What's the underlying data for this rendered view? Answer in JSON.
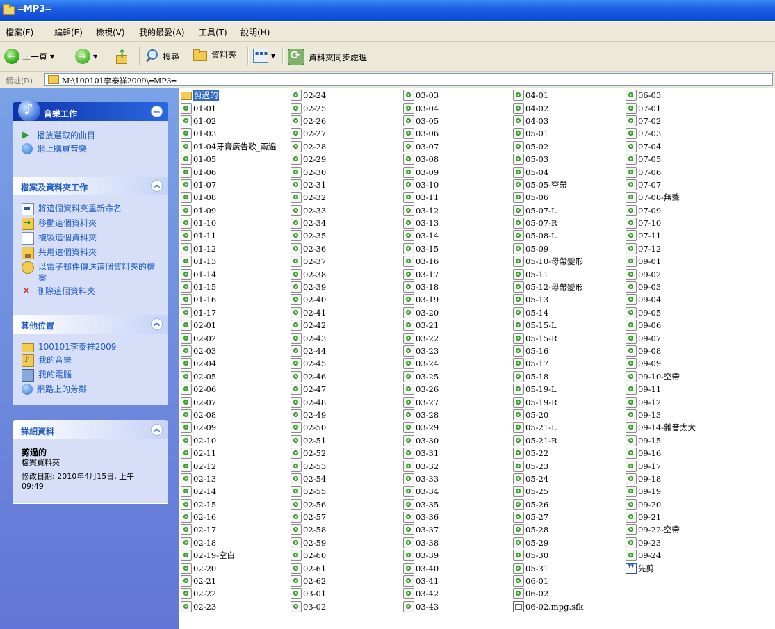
{
  "window": {
    "title": "═MP3═"
  },
  "menu": [
    "檔案(F)",
    "編輯(E)",
    "檢視(V)",
    "我的最愛(A)",
    "工具(T)",
    "說明(H)"
  ],
  "toolbar": {
    "back": "上一頁",
    "search": "搜尋",
    "folders": "資料夾",
    "sync": "資料夾同步處理"
  },
  "address": {
    "label": "網址(D)",
    "path": "M:\\100101李泰祥2009\\═MP3═"
  },
  "music_tasks": {
    "title": "音樂工作",
    "items": [
      "播放選取的曲目",
      "網上購買音樂"
    ]
  },
  "file_tasks": {
    "title": "檔案及資料夾工作",
    "items": [
      "將這個資料夾重新命名",
      "移動這個資料夾",
      "複製這個資料夾",
      "共用這個資料夾",
      "以電子郵件傳送這個資料夾的檔案",
      "刪除這個資料夾"
    ]
  },
  "other_places": {
    "title": "其他位置",
    "items": [
      "100101李泰祥2009",
      "我的音樂",
      "我的電腦",
      "網路上的芳鄰"
    ]
  },
  "details": {
    "title": "詳細資料",
    "name": "剪過的",
    "type": "檔案資料夾",
    "modified": "修改日期: 2010年4月15日, 上午 09:49"
  },
  "files": [
    [
      {
        "name": "剪過的",
        "type": "folder",
        "selected": true
      },
      {
        "name": "01-01"
      },
      {
        "name": "01-02"
      },
      {
        "name": "01-03"
      },
      {
        "name": "01-04牙膏廣告歌_兩遍"
      },
      {
        "name": "01-05"
      },
      {
        "name": "01-06"
      },
      {
        "name": "01-07"
      },
      {
        "name": "01-08"
      },
      {
        "name": "01-09"
      },
      {
        "name": "01-10"
      },
      {
        "name": "01-11"
      },
      {
        "name": "01-12"
      },
      {
        "name": "01-13"
      },
      {
        "name": "01-14"
      },
      {
        "name": "01-15"
      },
      {
        "name": "01-16"
      },
      {
        "name": "01-17"
      },
      {
        "name": "02-01"
      },
      {
        "name": "02-02"
      },
      {
        "name": "02-03"
      },
      {
        "name": "02-04"
      },
      {
        "name": "02-05"
      },
      {
        "name": "02-06"
      },
      {
        "name": "02-07"
      },
      {
        "name": "02-08"
      },
      {
        "name": "02-09"
      },
      {
        "name": "02-10"
      },
      {
        "name": "02-11"
      },
      {
        "name": "02-12"
      },
      {
        "name": "02-13"
      },
      {
        "name": "02-14"
      },
      {
        "name": "02-15"
      },
      {
        "name": "02-16"
      },
      {
        "name": "02-17"
      },
      {
        "name": "02-18"
      },
      {
        "name": "02-19-空白"
      },
      {
        "name": "02-20"
      },
      {
        "name": "02-21"
      },
      {
        "name": "02-22"
      },
      {
        "name": "02-23"
      }
    ],
    [
      {
        "name": "02-24"
      },
      {
        "name": "02-25"
      },
      {
        "name": "02-26"
      },
      {
        "name": "02-27"
      },
      {
        "name": "02-28"
      },
      {
        "name": "02-29"
      },
      {
        "name": "02-30"
      },
      {
        "name": "02-31"
      },
      {
        "name": "02-32"
      },
      {
        "name": "02-33"
      },
      {
        "name": "02-34"
      },
      {
        "name": "02-35"
      },
      {
        "name": "02-36"
      },
      {
        "name": "02-37"
      },
      {
        "name": "02-38"
      },
      {
        "name": "02-39"
      },
      {
        "name": "02-40"
      },
      {
        "name": "02-41"
      },
      {
        "name": "02-42"
      },
      {
        "name": "02-43"
      },
      {
        "name": "02-44"
      },
      {
        "name": "02-45"
      },
      {
        "name": "02-46"
      },
      {
        "name": "02-47"
      },
      {
        "name": "02-48"
      },
      {
        "name": "02-49"
      },
      {
        "name": "02-50"
      },
      {
        "name": "02-51"
      },
      {
        "name": "02-52"
      },
      {
        "name": "02-53"
      },
      {
        "name": "02-54"
      },
      {
        "name": "02-55"
      },
      {
        "name": "02-56"
      },
      {
        "name": "02-57"
      },
      {
        "name": "02-58"
      },
      {
        "name": "02-59"
      },
      {
        "name": "02-60"
      },
      {
        "name": "02-61"
      },
      {
        "name": "02-62"
      },
      {
        "name": "03-01"
      },
      {
        "name": "03-02"
      }
    ],
    [
      {
        "name": "03-03"
      },
      {
        "name": "03-04"
      },
      {
        "name": "03-05"
      },
      {
        "name": "03-06"
      },
      {
        "name": "03-07"
      },
      {
        "name": "03-08"
      },
      {
        "name": "03-09"
      },
      {
        "name": "03-10"
      },
      {
        "name": "03-11"
      },
      {
        "name": "03-12"
      },
      {
        "name": "03-13"
      },
      {
        "name": "03-14"
      },
      {
        "name": "03-15"
      },
      {
        "name": "03-16"
      },
      {
        "name": "03-17"
      },
      {
        "name": "03-18"
      },
      {
        "name": "03-19"
      },
      {
        "name": "03-20"
      },
      {
        "name": "03-21"
      },
      {
        "name": "03-22"
      },
      {
        "name": "03-23"
      },
      {
        "name": "03-24"
      },
      {
        "name": "03-25"
      },
      {
        "name": "03-26"
      },
      {
        "name": "03-27"
      },
      {
        "name": "03-28"
      },
      {
        "name": "03-29"
      },
      {
        "name": "03-30"
      },
      {
        "name": "03-31"
      },
      {
        "name": "03-32"
      },
      {
        "name": "03-33"
      },
      {
        "name": "03-34"
      },
      {
        "name": "03-35"
      },
      {
        "name": "03-36"
      },
      {
        "name": "03-37"
      },
      {
        "name": "03-38"
      },
      {
        "name": "03-39"
      },
      {
        "name": "03-40"
      },
      {
        "name": "03-41"
      },
      {
        "name": "03-42"
      },
      {
        "name": "03-43"
      }
    ],
    [
      {
        "name": "04-01"
      },
      {
        "name": "04-02"
      },
      {
        "name": "04-03"
      },
      {
        "name": "05-01"
      },
      {
        "name": "05-02"
      },
      {
        "name": "05-03"
      },
      {
        "name": "05-04"
      },
      {
        "name": "05-05-空帶"
      },
      {
        "name": "05-06"
      },
      {
        "name": "05-07-L"
      },
      {
        "name": "05-07-R"
      },
      {
        "name": "05-08-L"
      },
      {
        "name": "05-09"
      },
      {
        "name": "05-10-母帶變形"
      },
      {
        "name": "05-11"
      },
      {
        "name": "05-12-母帶變形"
      },
      {
        "name": "05-13"
      },
      {
        "name": "05-14"
      },
      {
        "name": "05-15-L"
      },
      {
        "name": "05-15-R"
      },
      {
        "name": "05-16"
      },
      {
        "name": "05-17"
      },
      {
        "name": "05-18"
      },
      {
        "name": "05-19-L"
      },
      {
        "name": "05-19-R"
      },
      {
        "name": "05-20"
      },
      {
        "name": "05-21-L"
      },
      {
        "name": "05-21-R"
      },
      {
        "name": "05-22"
      },
      {
        "name": "05-23"
      },
      {
        "name": "05-24"
      },
      {
        "name": "05-25"
      },
      {
        "name": "05-26"
      },
      {
        "name": "05-27"
      },
      {
        "name": "05-28"
      },
      {
        "name": "05-29"
      },
      {
        "name": "05-30"
      },
      {
        "name": "05-31"
      },
      {
        "name": "06-01"
      },
      {
        "name": "06-02"
      },
      {
        "name": "06-02.mpg.sfk",
        "type": "sfk"
      }
    ],
    [
      {
        "name": "06-03"
      },
      {
        "name": "07-01"
      },
      {
        "name": "07-02"
      },
      {
        "name": "07-03"
      },
      {
        "name": "07-04"
      },
      {
        "name": "07-05"
      },
      {
        "name": "07-06"
      },
      {
        "name": "07-07"
      },
      {
        "name": "07-08-無聲"
      },
      {
        "name": "07-09"
      },
      {
        "name": "07-10"
      },
      {
        "name": "07-11"
      },
      {
        "name": "07-12"
      },
      {
        "name": "09-01"
      },
      {
        "name": "09-02"
      },
      {
        "name": "09-03"
      },
      {
        "name": "09-04"
      },
      {
        "name": "09-05"
      },
      {
        "name": "09-06"
      },
      {
        "name": "09-07"
      },
      {
        "name": "09-08"
      },
      {
        "name": "09-09"
      },
      {
        "name": "09-10-空帶"
      },
      {
        "name": "09-11"
      },
      {
        "name": "09-12"
      },
      {
        "name": "09-13"
      },
      {
        "name": "09-14-雜音太大"
      },
      {
        "name": "09-15"
      },
      {
        "name": "09-16"
      },
      {
        "name": "09-17"
      },
      {
        "name": "09-18"
      },
      {
        "name": "09-19"
      },
      {
        "name": "09-20"
      },
      {
        "name": "09-21"
      },
      {
        "name": "09-22-空帶"
      },
      {
        "name": "09-23"
      },
      {
        "name": "09-24"
      },
      {
        "name": "先剪",
        "type": "doc"
      }
    ]
  ]
}
